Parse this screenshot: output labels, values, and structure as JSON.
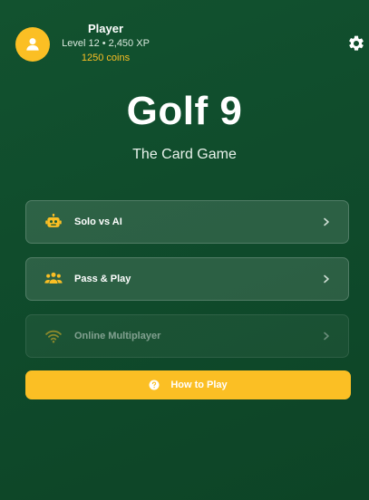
{
  "profile": {
    "name": "Player",
    "level_text": "Level 12 • 2,450 XP",
    "coins_text": "1250 coins",
    "avatar_icon": "user-icon"
  },
  "header": {
    "settings_icon": "gear-icon"
  },
  "title": "Golf 9",
  "subtitle": "The Card Game",
  "menu": {
    "solo": {
      "label": "Solo vs AI",
      "icon": "robot-icon",
      "enabled": true
    },
    "pass_play": {
      "label": "Pass & Play",
      "icon": "users-icon",
      "enabled": true
    },
    "online": {
      "label": "Online Multiplayer",
      "icon": "wifi-icon",
      "enabled": false
    }
  },
  "how_to_play": {
    "label": "How to Play",
    "icon": "question-circle-icon"
  },
  "colors": {
    "background": "#0f4a2b",
    "accent": "#fbbf24",
    "text": "#ffffff"
  }
}
